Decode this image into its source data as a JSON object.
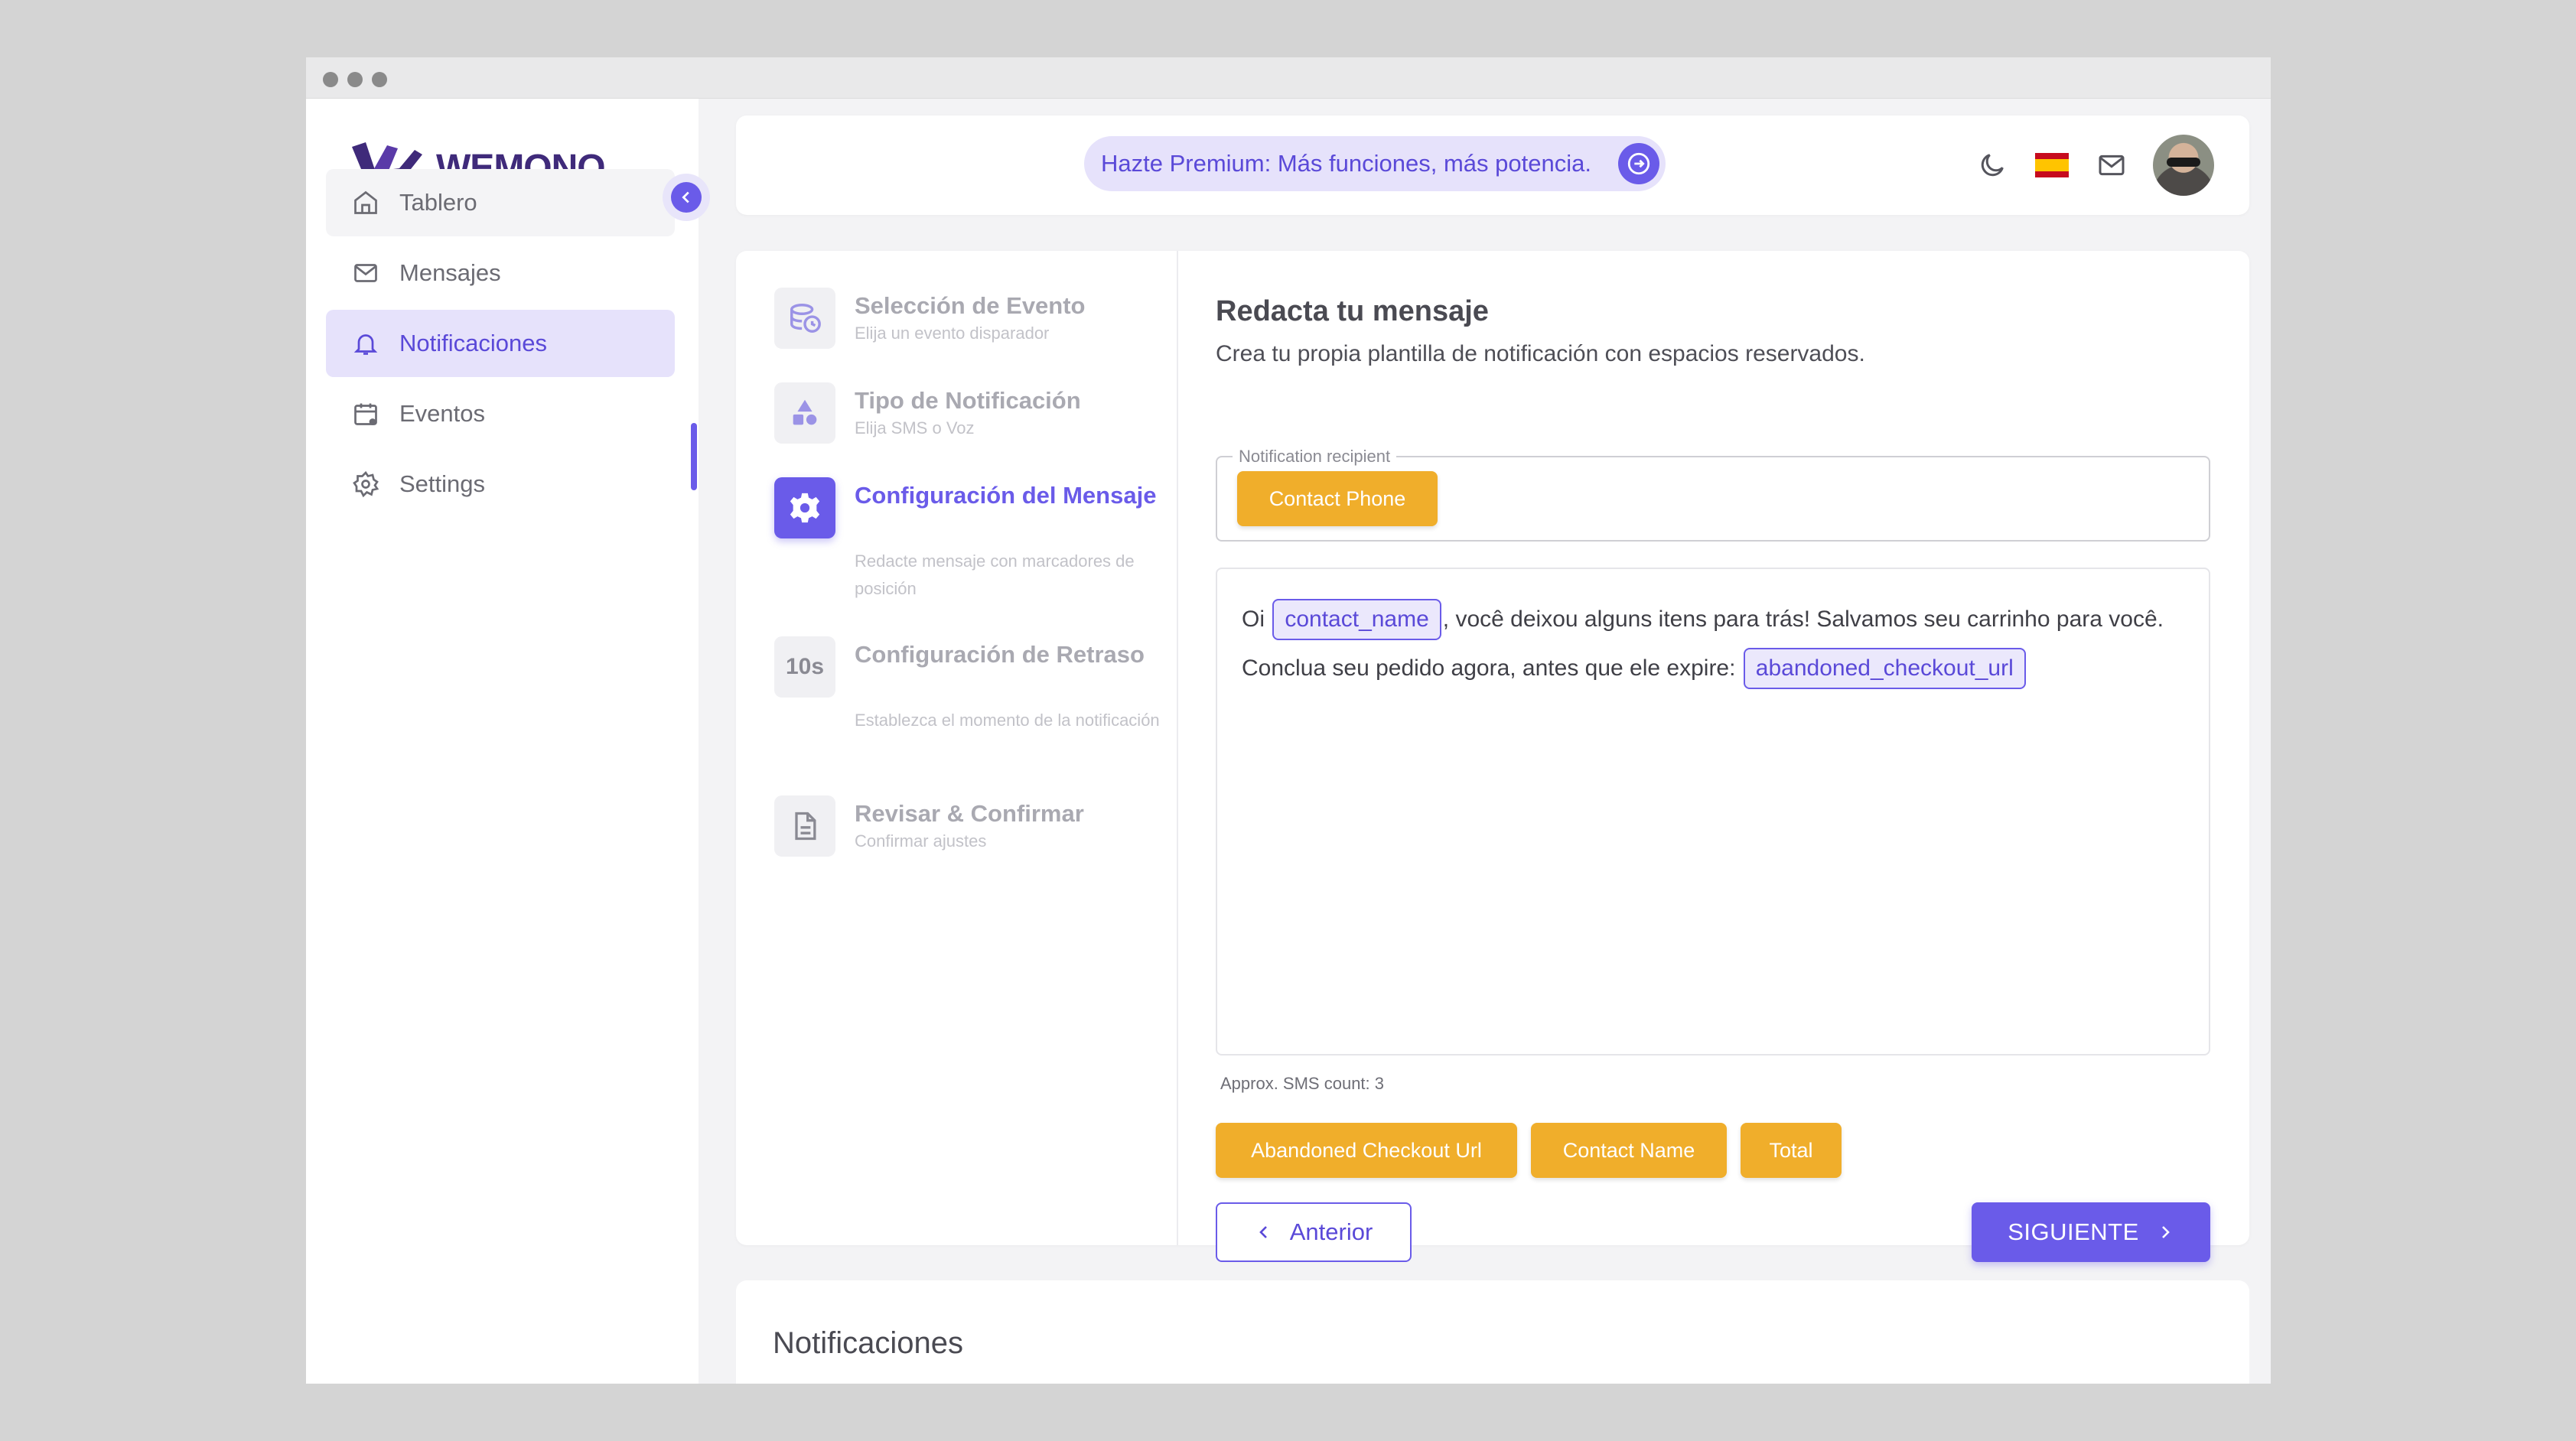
{
  "brand": {
    "name": "WEMONO"
  },
  "sidebar": {
    "items": [
      {
        "label": "Tablero",
        "icon": "home-icon"
      },
      {
        "label": "Mensajes",
        "icon": "mail-icon"
      },
      {
        "label": "Notificaciones",
        "icon": "bell-icon",
        "active": true
      },
      {
        "label": "Eventos",
        "icon": "calendar-icon"
      },
      {
        "label": "Settings",
        "icon": "gear-icon"
      }
    ]
  },
  "header": {
    "premium_text": "Hazte Premium: Más funciones, más potencia.",
    "icons": [
      "moon-icon",
      "spain-flag-icon",
      "mail-icon",
      "avatar"
    ]
  },
  "stepper": {
    "steps": [
      {
        "title": "Selección de Evento",
        "subtitle": "Elija un evento disparador",
        "icon": "database-clock-icon"
      },
      {
        "title": "Tipo de Notificación",
        "subtitle": "Elija SMS o Voz",
        "icon": "shapes-icon"
      },
      {
        "title": "Configuración del Mensaje",
        "subtitle": "Redacte mensaje con marcadores de posición",
        "icon": "gear-icon",
        "active": true
      },
      {
        "title": "Configuración de Retraso",
        "subtitle": "Establezca el momento de la notificación",
        "icon_text": "10s"
      },
      {
        "title": "Revisar & Confirmar",
        "subtitle": "Confirmar ajustes",
        "icon": "document-icon"
      }
    ]
  },
  "compose": {
    "title": "Redacta tu mensaje",
    "subtitle": "Crea tu propia plantilla de notificación con espacios reservados.",
    "recipient_label": "Notification recipient",
    "recipient_chip": "Contact Phone",
    "message": {
      "part1": "Oi ",
      "ph1": "contact_name",
      "part2": ", você deixou alguns itens para trás! Salvamos seu carrinho para você. Conclua seu pedido agora, antes que ele expire: ",
      "ph2": "abandoned_checkout_url"
    },
    "sms_count": "Approx. SMS count: 3",
    "placeholders": [
      "Abandoned Checkout Url",
      "Contact Name",
      "Total"
    ],
    "prev_label": "Anterior",
    "next_label": "SIGUIENTE"
  },
  "section2": {
    "title": "Notificaciones"
  },
  "colors": {
    "accent": "#6a5be9",
    "chip": "#f0ae2b",
    "brand": "#3f2a7a"
  }
}
